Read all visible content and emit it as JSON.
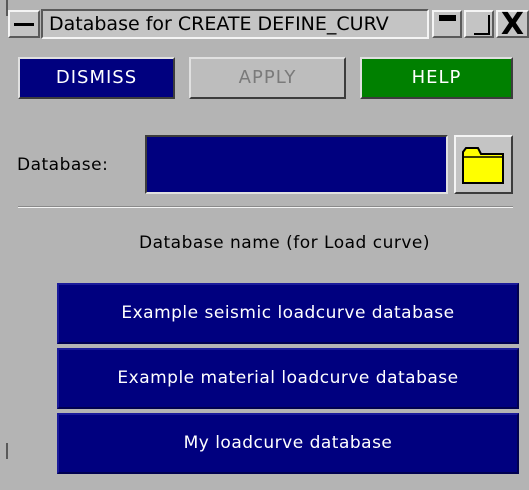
{
  "window": {
    "title": "Database for CREATE DEFINE_CURV",
    "icons": {
      "menu": "window-menu-icon",
      "minimize": "minimize-icon",
      "maximize": "maximize-icon",
      "close": "close-icon"
    },
    "close_glyph": "X"
  },
  "actions": {
    "dismiss_label": "DISMISS",
    "apply_label": "APPLY",
    "help_label": "HELP"
  },
  "database": {
    "label": "Database:",
    "value": "",
    "browse_icon": "folder-icon"
  },
  "list": {
    "heading": "Database name (for Load curve)",
    "items": [
      {
        "label": "Example seismic loadcurve database"
      },
      {
        "label": "Example material loadcurve database"
      },
      {
        "label": "My loadcurve database"
      }
    ]
  },
  "colors": {
    "background": "#b4b4b4",
    "dismiss": "#00007f",
    "apply": "#bdbdbd",
    "help": "#008000",
    "list_item": "#00007f",
    "folder": "#ffff00"
  }
}
